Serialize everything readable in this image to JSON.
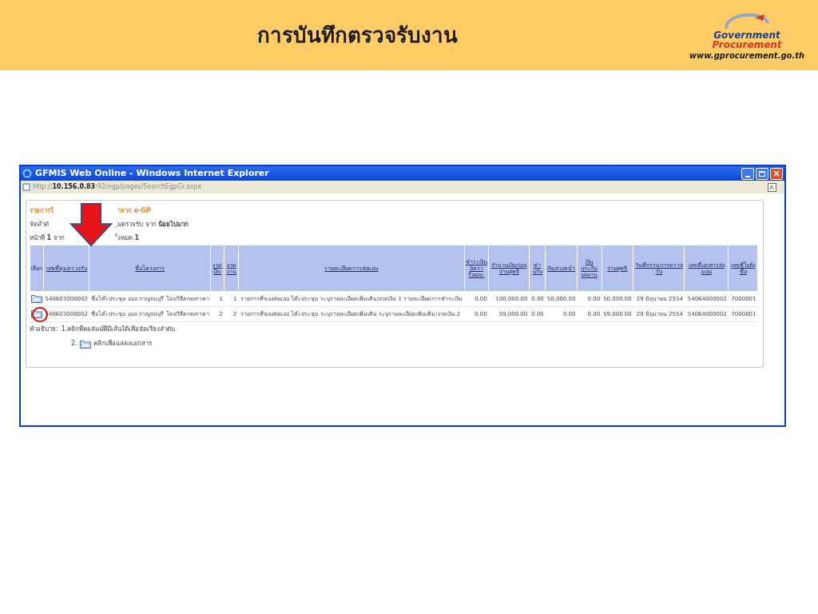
{
  "slide": {
    "title": "การบันทึกตรวจรับงาน",
    "logo_line_1": "Government",
    "logo_line_2": "Procurement",
    "url": "www.gprocurement.go.th"
  },
  "window": {
    "title": "GFMIS Web Online - Windows Internet Explorer",
    "address_prefix": "http://",
    "address_host": "10.156.0.83",
    "address_rest": ":92/egp/pages/SearchEgpGr.aspx"
  },
  "page": {
    "heading_parts": [
      "รายการใ",
      "าจาก e-GP"
    ],
    "sort_line_parts": [
      "จัดลำดั",
      "ุมตรวจรับ จาก ",
      "น้อยไปมาก"
    ],
    "page_line_parts": [
      "หน้าที่ ",
      "1",
      " จาก",
      "ั้งหมด ",
      "1"
    ]
  },
  "table": {
    "columns": [
      "เลือก",
      "เลขที่คุมตรวจรับ",
      "ชื่อโครงการ",
      "งวดเงิน",
      "งวดงาน",
      "รายละเอียดการส่งมอบ",
      "ชำระเงินอัตราร้อยละ",
      "จำนวนเงินก่อนจ่ายสุทธิ",
      "ค่าปรับ",
      "เงินล่วงหน้า",
      "เงินประกันผลงาน",
      "จ่ายสุทธิ",
      "วันที่กรรมการตรวจรับ",
      "เลขที่เอกสารส่งมอบ",
      "เลขที่ใบสั่งซื้อ"
    ],
    "rows": [
      {
        "circled": false,
        "cells": [
          "",
          "540603000002",
          "ชื่อโต๊ะประชุม อบจ กาญจนบุรี โดยวิธีตกลงราคา",
          "1",
          "1",
          "รายการที่ของส่งมอบ โต๊ะประชุม ระบุรายละเอียดเพิ่มเติม/งวดเงิน 1 รายละเอียดการชำระเงิน",
          "0.00",
          "100,000.00",
          "0.00",
          "50,000.00",
          "0.00",
          "50,000.00",
          "29 มิถุนายน 2554",
          "54064000002",
          "7000001"
        ]
      },
      {
        "circled": true,
        "cells": [
          "",
          "540603000002",
          "ชื่อโต๊ะประชุม อบจ กาญจนบุรี โดยวิธีตกลงราคา",
          "2",
          "2",
          "รายการที่ของส่งมอบ โต๊ะประชุม ระบุรายละเอียดเพิ่มเติม ระบุรายละเอียดเพิ่มเติม/งวดเงิน 2",
          "0.00",
          "59,000.00",
          "0.00",
          "0.00",
          "0.00",
          "59,000.00",
          "29 มิถุนายน 2554",
          "54064000002",
          "7000001"
        ]
      }
    ]
  },
  "legend": {
    "label": "คำอธิบาย:",
    "item_1": "1.คลิกที่คอลัมน์ที่มีเส้นใต้เพื่อจัดเรียงลำดับ",
    "item_2_number": "2.",
    "item_2_text": "คลิกเพื่อแสดงเอกสาร"
  }
}
